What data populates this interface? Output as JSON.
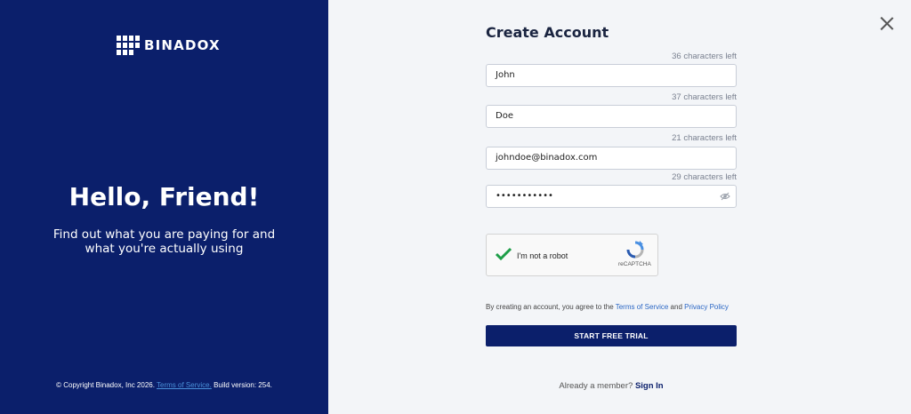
{
  "left_panel": {
    "logo_text": "BINADOX",
    "heading": "Hello, Friend!",
    "tagline_line1": "Find out what you are paying for and",
    "tagline_line2": "what you're actually using",
    "footer_prefix": "© Copyright Binadox, Inc 2026.",
    "footer_terms_link": "Terms of Service.",
    "footer_build": "Build version: 254.",
    "background_color": "#0b1f6b"
  },
  "form": {
    "title": "Create Account",
    "fields": [
      {
        "counter": "36 characters left",
        "value": "John"
      },
      {
        "counter": "37 characters left",
        "value": "Doe"
      },
      {
        "counter": "21 characters left",
        "value": "johndoe@binadox.com"
      },
      {
        "counter": "29 characters left",
        "value": "•••••••••••"
      }
    ],
    "captcha": {
      "label": "I'm not a robot",
      "brand": "reCAPTCHA",
      "checked": true
    },
    "terms_prefix": "By creating an account, you agree to the",
    "terms_link": "Terms of Service",
    "terms_and": "and",
    "privacy_link": "Privacy Policy",
    "submit_label": "START FREE TRIAL",
    "member_text": "Already a member?",
    "signin_link": "Sign In",
    "accent_color": "#0b1f6b",
    "link_color": "#2a66c4"
  },
  "icons": {
    "close": "close-icon",
    "eye": "eye-off-icon",
    "check": "checkmark-icon",
    "recaptcha": "recaptcha-logo-icon"
  }
}
